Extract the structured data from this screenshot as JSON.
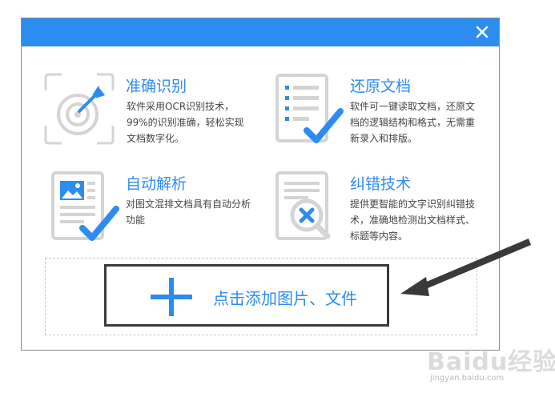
{
  "dialog": {
    "close_icon": "close-icon"
  },
  "features": [
    {
      "title": "准确识别",
      "desc": "软件采用OCR识别技术，99%的识别准确，轻松实现文档数字化。",
      "icon": "target-arrow-icon"
    },
    {
      "title": "还原文档",
      "desc": "软件可一键读取文档，还原文档的逻辑结构和格式，无需重新录入和排版。",
      "icon": "document-check-icon"
    },
    {
      "title": "自动解析",
      "desc": "对图文混排文档具有自动分析功能",
      "icon": "image-document-check-icon"
    },
    {
      "title": "纠错技术",
      "desc": "提供更智能的文字识别纠错技术，准确地检测出文档样式、标题等内容。",
      "icon": "document-magnifier-icon"
    }
  ],
  "add_file": {
    "label": "点击添加图片、文件",
    "icon": "plus-icon"
  },
  "watermark": {
    "logo": "Baidu经验",
    "url": "jingyan.baidu.com"
  },
  "colors": {
    "accent": "#2d8cf0",
    "icon_gray": "#d4d4d4",
    "annotation": "#3a3a3a"
  }
}
